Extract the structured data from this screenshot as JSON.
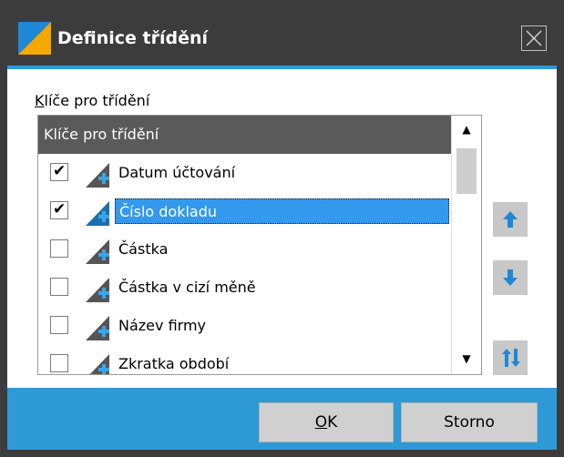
{
  "window": {
    "title": "Definice třídění",
    "accent_color": "#2d9ad6",
    "titlebar_color": "#3c3c3c",
    "app_icon": "app-logo-icon",
    "close_icon": "close-icon"
  },
  "group": {
    "label_mnemonic": "K",
    "label_rest": "líče pro třídění"
  },
  "list": {
    "header": "Klíče pro třídění",
    "items": [
      {
        "label": "Datum účtování",
        "checked": true,
        "selected": false
      },
      {
        "label": "Číslo dokladu",
        "checked": true,
        "selected": true
      },
      {
        "label": "Částka",
        "checked": false,
        "selected": false
      },
      {
        "label": "Částka v cizí měně",
        "checked": false,
        "selected": false
      },
      {
        "label": "Název firmy",
        "checked": false,
        "selected": false
      },
      {
        "label": "Zkratka období",
        "checked": false,
        "selected": false
      }
    ],
    "check_glyph": "✔",
    "scroll_up_glyph": "▲",
    "scroll_down_glyph": "▼",
    "selection_color": "#3399ee"
  },
  "side_buttons": {
    "move_up_icon": "arrow-up-icon",
    "move_down_icon": "arrow-down-icon",
    "toggle_order_icon": "sort-order-icon"
  },
  "footer": {
    "ok_mnemonic": "O",
    "ok_rest": "K",
    "cancel_label": "Storno"
  }
}
